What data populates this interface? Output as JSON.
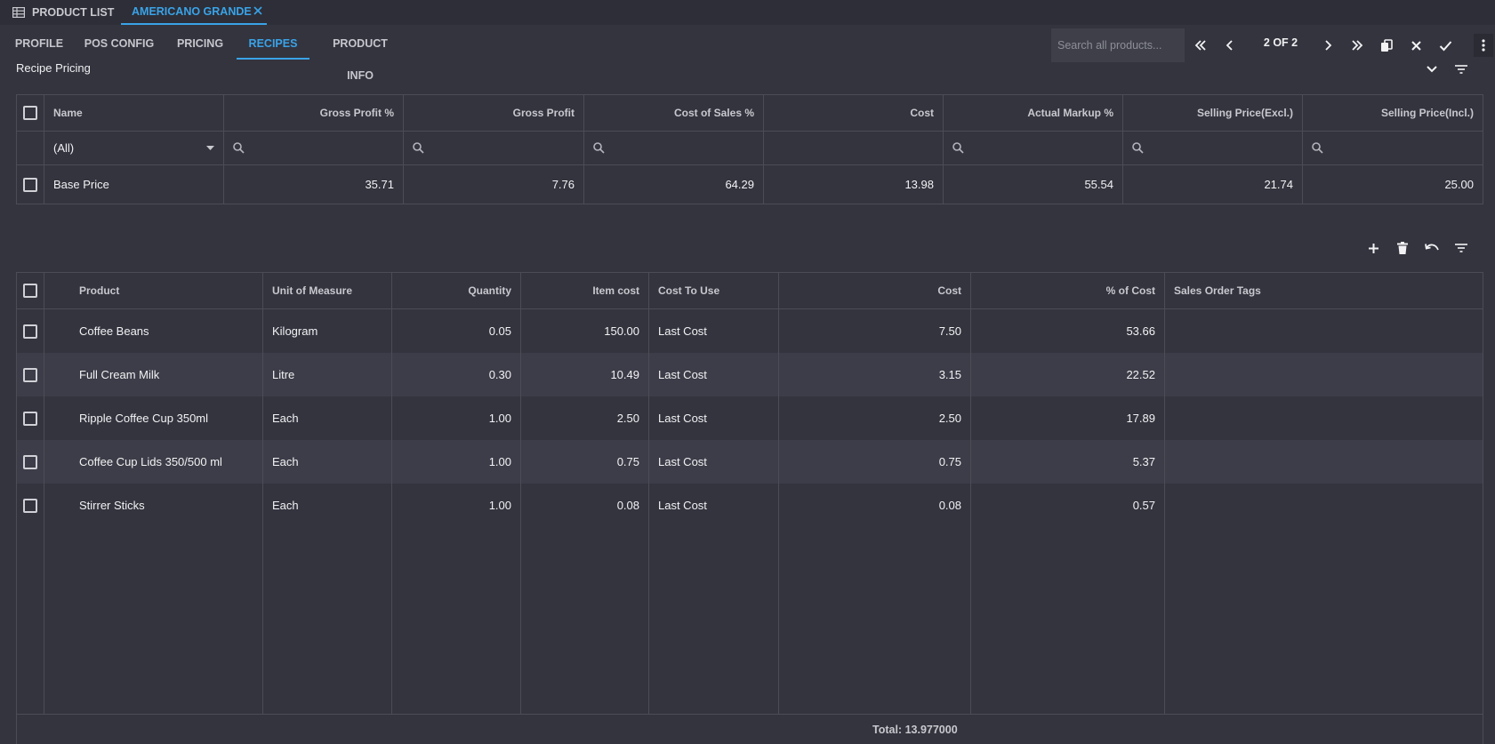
{
  "tabs": {
    "product_list": "PRODUCT LIST",
    "active_doc": "AMERICANO GRANDE"
  },
  "sections": [
    "PROFILE",
    "POS CONFIG",
    "PRICING",
    "RECIPES",
    "PRODUCT INFO"
  ],
  "active_section": "RECIPES",
  "search": {
    "placeholder": "Search all products..."
  },
  "pager": {
    "text": "2 OF 2"
  },
  "recipe_pricing": {
    "title": "Recipe Pricing",
    "columns": [
      "Name",
      "Gross Profit %",
      "Gross Profit",
      "Cost of Sales %",
      "Cost",
      "Actual Markup %",
      "Selling Price(Excl.)",
      "Selling Price(Incl.)"
    ],
    "name_filter": "(All)",
    "rows": [
      {
        "name": "Base Price",
        "gross_profit_pct": "35.71",
        "gross_profit": "7.76",
        "cost_of_sales_pct": "64.29",
        "cost": "13.98",
        "actual_markup_pct": "55.54",
        "selling_excl": "21.74",
        "selling_incl": "25.00"
      }
    ]
  },
  "recipe_items": {
    "columns": [
      "Product",
      "Unit of Measure",
      "Quantity",
      "Item cost",
      "Cost To Use",
      "Cost",
      "% of Cost",
      "Sales Order Tags"
    ],
    "rows": [
      {
        "product": "Coffee Beans",
        "uom": "Kilogram",
        "quantity": "0.05",
        "item_cost": "150.00",
        "cost_to_use": "Last Cost",
        "cost": "7.50",
        "pct_cost": "53.66",
        "tags": ""
      },
      {
        "product": "Full Cream Milk",
        "uom": "Litre",
        "quantity": "0.30",
        "item_cost": "10.49",
        "cost_to_use": "Last Cost",
        "cost": "3.15",
        "pct_cost": "22.52",
        "tags": ""
      },
      {
        "product": "Ripple Coffee Cup 350ml",
        "uom": "Each",
        "quantity": "1.00",
        "item_cost": "2.50",
        "cost_to_use": "Last Cost",
        "cost": "2.50",
        "pct_cost": "17.89",
        "tags": ""
      },
      {
        "product": "Coffee Cup Lids 350/500 ml",
        "uom": "Each",
        "quantity": "1.00",
        "item_cost": "0.75",
        "cost_to_use": "Last Cost",
        "cost": "0.75",
        "pct_cost": "5.37",
        "tags": ""
      },
      {
        "product": "Stirrer Sticks",
        "uom": "Each",
        "quantity": "1.00",
        "item_cost": "0.08",
        "cost_to_use": "Last Cost",
        "cost": "0.08",
        "pct_cost": "0.57",
        "tags": ""
      }
    ],
    "total": "Total: 13.977000"
  },
  "colors": {
    "accent": "#3aa3e8",
    "background": "#33343e",
    "row_alt": "#3c3d48"
  },
  "icons": [
    "grid-icon",
    "close-icon",
    "first-page-icon",
    "prev-page-icon",
    "next-page-icon",
    "last-page-icon",
    "copy-icon",
    "discard-icon",
    "save-check-icon",
    "more-vert-icon",
    "chevron-down-icon",
    "filter-icon",
    "add-icon",
    "delete-icon",
    "undo-icon",
    "search-icon",
    "dropdown-caret-icon"
  ]
}
